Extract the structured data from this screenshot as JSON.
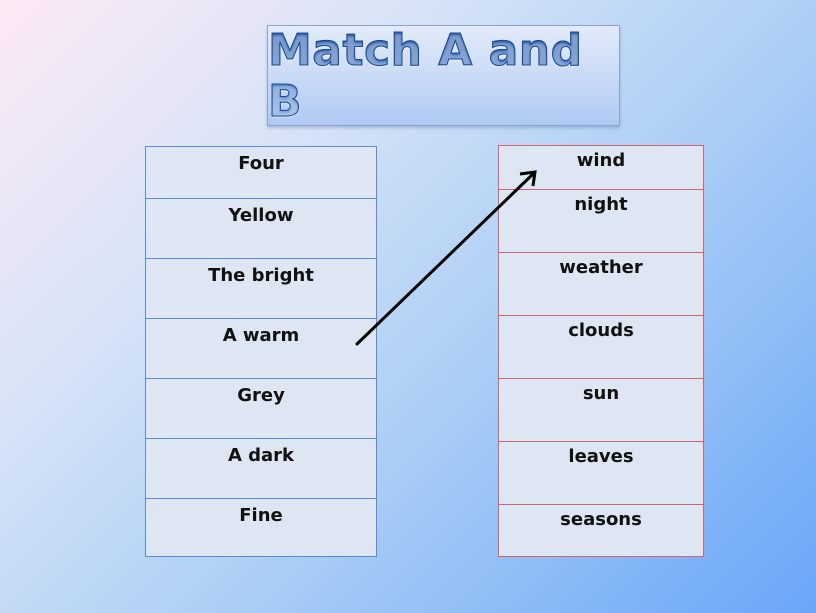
{
  "title": "Match A and B",
  "column_a": [
    "Four",
    "Yellow",
    "The bright",
    "A warm",
    "Grey",
    "A dark",
    "Fine"
  ],
  "column_b": [
    "wind",
    "night",
    "weather",
    "clouds",
    "sun",
    "leaves",
    "seasons"
  ],
  "example_match": {
    "from": "A warm",
    "to": "wind"
  },
  "colors": {
    "column_a_border": "#5b8ccc",
    "column_b_border": "#d3646f",
    "cell_fill": "#dde6f2",
    "title_text": "#1d4f9e",
    "arrow": "#000000"
  }
}
